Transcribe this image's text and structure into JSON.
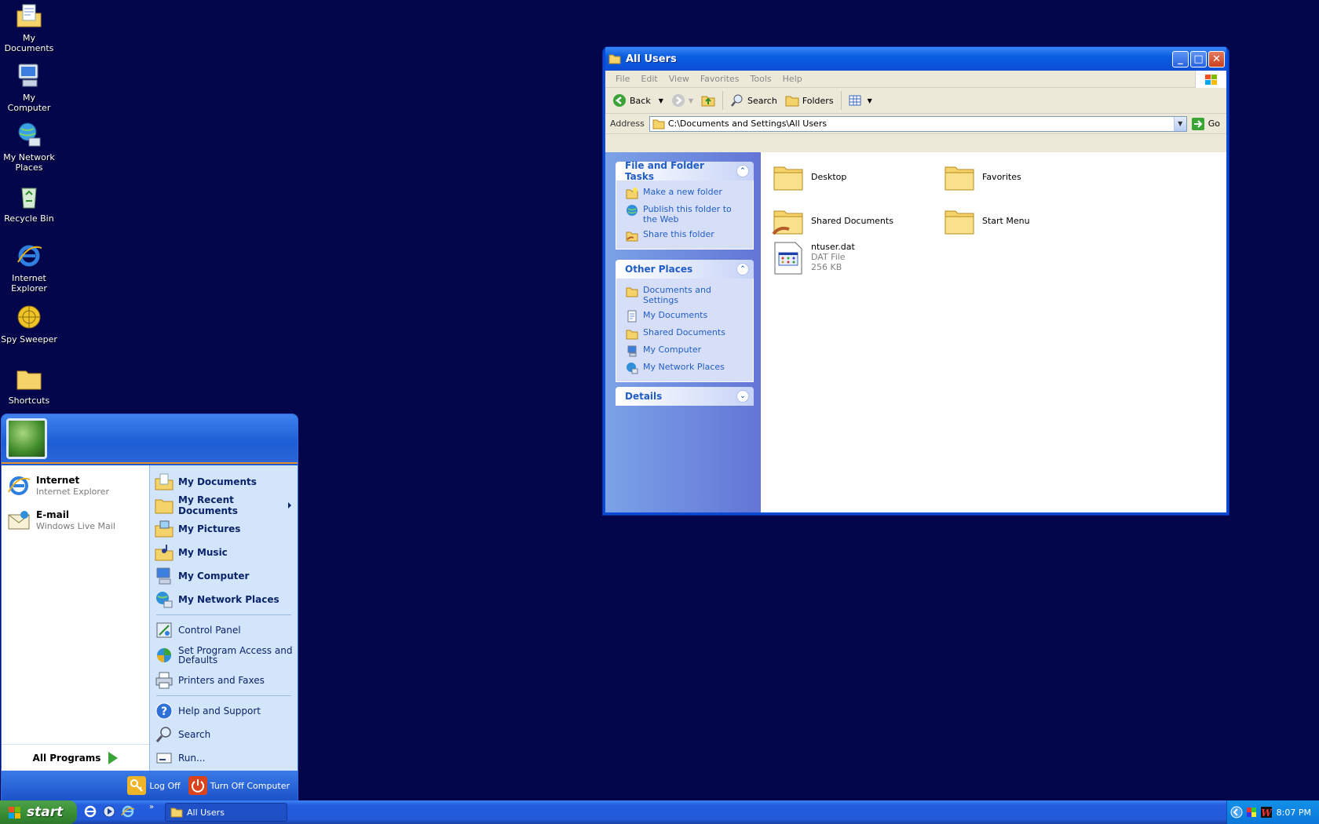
{
  "desktop_icons": [
    {
      "label": "My Documents",
      "icon": "my-documents-icon"
    },
    {
      "label": "My Computer",
      "icon": "my-computer-icon"
    },
    {
      "label": "My Network Places",
      "icon": "network-places-icon"
    },
    {
      "label": "Recycle Bin",
      "icon": "recycle-bin-icon"
    },
    {
      "label": "Internet Explorer",
      "icon": "internet-explorer-icon"
    },
    {
      "label": "Spy Sweeper",
      "icon": "spy-sweeper-icon"
    },
    {
      "label": "Shortcuts",
      "icon": "folder-icon"
    }
  ],
  "window": {
    "title": "All Users",
    "menu": [
      "File",
      "Edit",
      "View",
      "Favorites",
      "Tools",
      "Help"
    ],
    "toolbar": {
      "back": "Back",
      "search": "Search",
      "folders": "Folders"
    },
    "address": {
      "label": "Address",
      "value": "C:\\Documents and Settings\\All Users",
      "go": "Go"
    },
    "tasks": {
      "title": "File and Folder Tasks",
      "items": [
        "Make a new folder",
        "Publish this folder to the Web",
        "Share this folder"
      ]
    },
    "other_places": {
      "title": "Other Places",
      "items": [
        "Documents and Settings",
        "My Documents",
        "Shared Documents",
        "My Computer",
        "My Network Places"
      ]
    },
    "details": {
      "title": "Details"
    },
    "files": [
      {
        "name": "Desktop",
        "type": "folder"
      },
      {
        "name": "Favorites",
        "type": "folder"
      },
      {
        "name": "Shared Documents",
        "type": "shared-folder"
      },
      {
        "name": "Start Menu",
        "type": "folder"
      },
      {
        "name": "ntuser.dat",
        "type": "DAT File",
        "size": "256 KB"
      }
    ]
  },
  "start_menu": {
    "pinned": [
      {
        "title": "Internet",
        "subtitle": "Internet Explorer"
      },
      {
        "title": "E-mail",
        "subtitle": "Windows Live Mail"
      }
    ],
    "all_programs": "All Programs",
    "right_bold": [
      "My Documents",
      "My Recent Documents",
      "My Pictures",
      "My Music",
      "My Computer",
      "My Network Places"
    ],
    "right_settings": [
      "Control Panel",
      "Set Program Access and Defaults",
      "Printers and Faxes"
    ],
    "right_tools": [
      "Help and Support",
      "Search",
      "Run..."
    ],
    "log_off": "Log Off",
    "turn_off": "Turn Off Computer"
  },
  "taskbar": {
    "start": "start",
    "task": "All Users",
    "clock": "8:07 PM"
  },
  "colors": {
    "desktop": "#03064a",
    "taskbar": "#245dde",
    "start_button": "#3a8f37",
    "task_pane": "#6375d6"
  }
}
